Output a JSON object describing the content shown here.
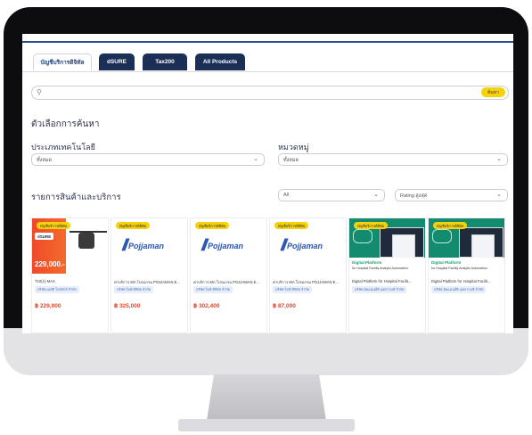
{
  "tabs": [
    {
      "label": "บัญชีบริการดิจิทัล",
      "active": true
    },
    {
      "label": "dSURE",
      "active": false
    },
    {
      "label": "Tax200",
      "active": false
    },
    {
      "label": "All Products",
      "active": false
    }
  ],
  "search": {
    "placeholder": "",
    "button_label": "ค้นหา"
  },
  "filters": {
    "heading": "ตัวเลือกการค้นหา",
    "tech_type_label": "ประเภทเทคโนโลยี",
    "tech_type_value": "ทั้งหมด",
    "category_label": "หมวดหมู่",
    "category_value": "ทั้งหมด"
  },
  "listing": {
    "heading": "รายการสินค้าและบริการ",
    "filter_value": "All",
    "sort_value": "Rating สูงสุด"
  },
  "colors": {
    "accent": "#f6d20e",
    "nav_dark": "#1b2f56",
    "price": "#e2452a"
  },
  "products": [
    {
      "kind": "drone",
      "badge": "บัญชีบริการดิจิทัล",
      "banner_price": "229,000.-",
      "banner_brand": "dSURE",
      "title": "T10(1)-MAX",
      "vendor": "บริษัท เอสที โปรดักส์ จำกัด",
      "price": "฿ 229,000"
    },
    {
      "kind": "pojjaman",
      "badge": "บัญชีบริการดิจิทัล",
      "logo_text": "Pojjaman",
      "title": "ค่าบริการ MA โปรแกรม POJJAMAN E...",
      "vendor": "บริษัท ไดท์ ดิจิทัล จำกัด",
      "price": "฿ 325,000"
    },
    {
      "kind": "pojjaman",
      "badge": "บัญชีบริการดิจิทัล",
      "logo_text": "Pojjaman",
      "title": "ค่าบริการ MA โปรแกรม POJJAMAN E...",
      "vendor": "บริษัท ไดท์ ดิจิทัล จำกัด",
      "price": "฿ 302,400"
    },
    {
      "kind": "pojjaman",
      "badge": "บัญชีบริการดิจิทัล",
      "logo_text": "Pojjaman",
      "title": "ค่าบริการ MA โปรแกรม POJJAMAN E...",
      "vendor": "บริษัท ไดท์ ดิจิทัล จำกัด",
      "price": "฿ 87,000"
    },
    {
      "kind": "digital",
      "badge": "บัญชีบริการดิจิทัล",
      "banner_title": "Digital Platform",
      "banner_sub": "for Hospital Facility Analytic Automation",
      "title": "Digital Platform for Hospital Facilit...",
      "vendor": "บริษัท อัพแมนส์ดิ แอดวานซ์ จำกัด",
      "price": ""
    },
    {
      "kind": "digital",
      "badge": "บัญชีบริการดิจิทัล",
      "banner_title": "Digital Platform",
      "banner_sub": "for Hospital Facility Analytic Automation",
      "title": "Digital Platform for Hospital Facilit...",
      "vendor": "บริษัท อัพแมนส์ดิ แอดวานซ์ จำกัด",
      "price": ""
    }
  ]
}
